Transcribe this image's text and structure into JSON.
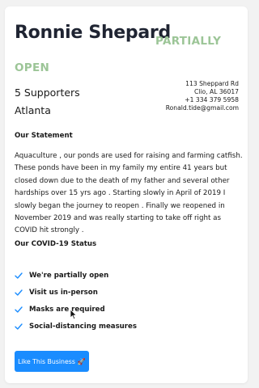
{
  "business": {
    "name": "Ronnie Shepard",
    "status_part1": "PARTIALLY",
    "status_part2": "OPEN",
    "supporters": "5 Supporters",
    "city": "Atlanta",
    "address": {
      "street": "113 Sheppard Rd",
      "city_state_zip": "Clio, AL 36017",
      "phone": "+1 334 379 5958",
      "email": "Ronald.tide@gmail.com"
    }
  },
  "statement": {
    "heading": "Our Statement",
    "text": "Aquaculture , our ponds are used for raising and farming catfish. These ponds have been in my family my entire 41 years but closed down due to the death of my father and several other hardships over 15 yrs ago . Starting slowly in April of 2019 I slowly began the journey to reopen . Finally we reopened in November 2019 and was really starting to take off right as COVID hit strongly ."
  },
  "covid": {
    "heading": "Our COVID-19 Status",
    "items": [
      {
        "label": "We're partially open",
        "icon": "check-icon"
      },
      {
        "label": "Visit us in-person",
        "icon": "check-icon"
      },
      {
        "label": "Masks are required",
        "icon": "check-icon"
      },
      {
        "label": "Social-distancing measures",
        "icon": "check-icon"
      }
    ]
  },
  "actions": {
    "like_label": "Like This Business",
    "like_icon": "rocket-icon",
    "like_glyph": "🚀"
  },
  "colors": {
    "status_green": "#9cc597",
    "button_blue": "#1a8cff",
    "check_blue": "#1a8cff",
    "name_dark": "#1f2432"
  }
}
